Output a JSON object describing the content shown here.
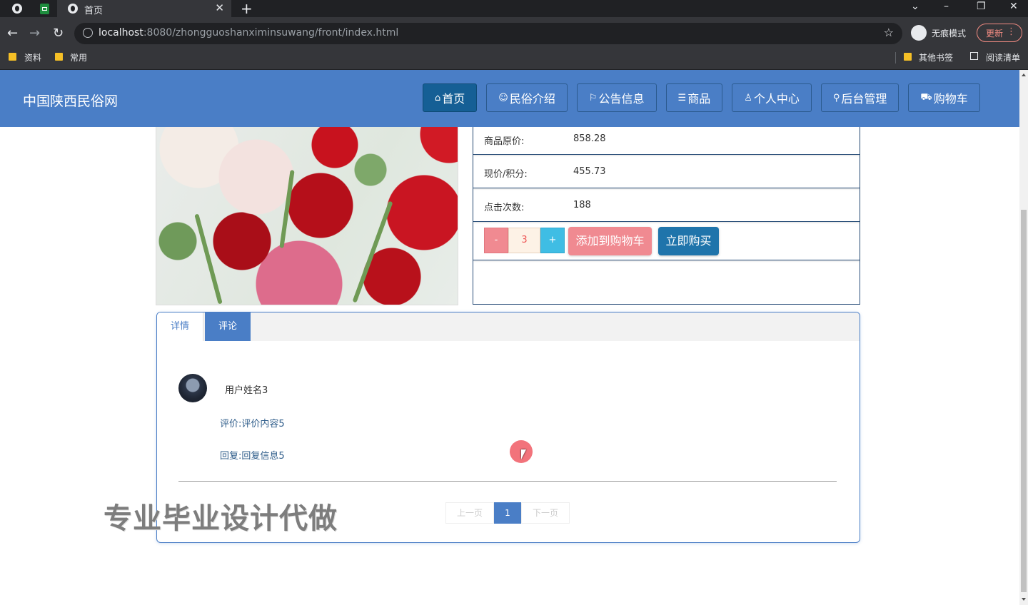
{
  "browser": {
    "tab_title": "首页",
    "url_host": "localhost",
    "url_rest": ":8080/zhongguoshanximinsuwang/front/index.html",
    "incognito_label": "无痕模式",
    "update_label": "更新",
    "bookmarks": [
      "资料",
      "常用"
    ],
    "other_bookmarks": "其他书签",
    "reading_list": "阅读清单"
  },
  "header": {
    "site_title": "中国陕西民俗网",
    "nav": [
      {
        "icon": "home-icon",
        "glyph": "⌂",
        "label": "首页"
      },
      {
        "icon": "palette-icon",
        "glyph": "☺",
        "label": "民俗介绍"
      },
      {
        "icon": "flag-icon",
        "glyph": "⚐",
        "label": "公告信息"
      },
      {
        "icon": "list-icon",
        "glyph": "☰",
        "label": "商品"
      },
      {
        "icon": "user-icon",
        "glyph": "♙",
        "label": "个人中心"
      },
      {
        "icon": "link-icon",
        "glyph": "⚲",
        "label": "后台管理"
      },
      {
        "icon": "cart-icon",
        "glyph": "⛟",
        "label": "购物车"
      }
    ]
  },
  "product": {
    "original_price_label": "商品原价:",
    "original_price": "858.28",
    "current_price_label": "现价/积分:",
    "current_price": "455.73",
    "clicks_label": "点击次数:",
    "clicks": "188",
    "qty_minus": "-",
    "qty_value": "3",
    "qty_plus": "+",
    "add_to_cart": "添加到购物车",
    "buy_now": "立即购买"
  },
  "tabs": {
    "details": "详情",
    "comments": "评论"
  },
  "comment": {
    "username": "用户姓名3",
    "review": "评价:评价内容5",
    "reply": "回复:回复信息5"
  },
  "pager": {
    "prev": "上一页",
    "current": "1",
    "next": "下一页"
  },
  "watermark": "专业毕业设计代做",
  "colors": {
    "header": "#4a7ec6",
    "nav_active": "#155f95",
    "cart_button": "#f08a91",
    "buy_button": "#1f74ab"
  }
}
